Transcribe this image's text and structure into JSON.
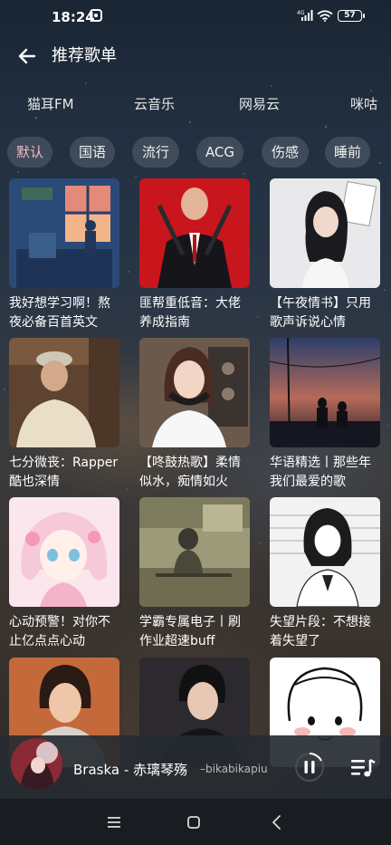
{
  "status_bar": {
    "time": "18:24",
    "signal": "4G",
    "battery": "57",
    "icons": [
      "app-notification-icon",
      "signal-icon",
      "wifi-icon",
      "battery-icon"
    ]
  },
  "header": {
    "title": "推荐歌单",
    "back_icon": "back-arrow-icon"
  },
  "source_tabs": [
    "猫耳FM",
    "云音乐",
    "网易云",
    "咪咕"
  ],
  "genre_chips": [
    {
      "label": "默认",
      "active": true
    },
    {
      "label": "国语",
      "active": false
    },
    {
      "label": "流行",
      "active": false
    },
    {
      "label": "ACG",
      "active": false
    },
    {
      "label": "伤感",
      "active": false
    },
    {
      "label": "睡前",
      "active": false
    }
  ],
  "playlists": [
    {
      "title": "我好想学习啊！熬夜必备百首英文",
      "cover": "anime-bedroom-window-night"
    },
    {
      "title": "匪帮重低音：大佬养成指南",
      "cover": "hitman-red-background"
    },
    {
      "title": "【午夜情书】只用歌声诉说心情",
      "cover": "girl-with-headphones"
    },
    {
      "title": "七分微丧：Rapper酷也深情",
      "cover": "man-in-cap-subway"
    },
    {
      "title": "【咚鼓热歌】柔情似水，痴情如火",
      "cover": "girl-with-headphones-studio"
    },
    {
      "title": "华语精选丨那些年我们最爱的歌",
      "cover": "sunset-silhouettes"
    },
    {
      "title": "心动预警！对你不止亿点点心动",
      "cover": "pastel-anime-girl"
    },
    {
      "title": "学霸专属电子丨刷作业超速buff",
      "cover": "lab-desk-room"
    },
    {
      "title": "失望片段：不想接着失望了",
      "cover": "manga-schoolgirl"
    },
    {
      "title": "",
      "cover": "young-man-portrait"
    },
    {
      "title": "",
      "cover": "man-dark-jacket"
    },
    {
      "title": "",
      "cover": "cartoon-face-sketch"
    }
  ],
  "now_playing": {
    "song": "Braska - 赤璃琴殇",
    "artist": "–bikabikapiu",
    "state": "playing",
    "icons": [
      "pause-icon",
      "playlist-icon"
    ]
  },
  "nav_bar": {
    "icons": [
      "menu-icon",
      "home-icon",
      "back-icon"
    ]
  }
}
